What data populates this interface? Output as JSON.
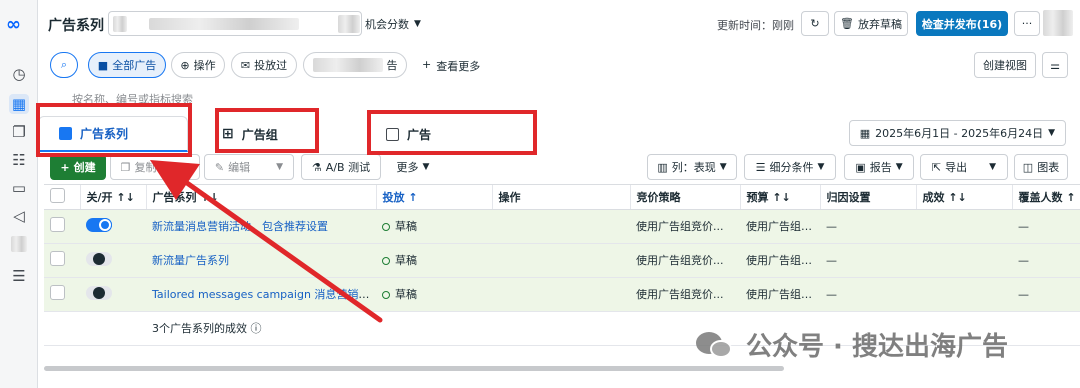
{
  "nav": {
    "meta_logo": "∞"
  },
  "header": {
    "title": "广告系列",
    "opportunity_score": "机会分数",
    "updated_time": "更新时间：刚刚",
    "discard_label": "放弃草稿",
    "publish_label": "检查并发布(16)",
    "more_label": "···"
  },
  "filters": {
    "all_ads": "全部广告",
    "actions": "操作",
    "delivered": "投放过",
    "blurred_suffix": "告",
    "view_more": "查看更多",
    "create_view": "创建视图"
  },
  "search": {
    "placeholder": "按名称、编号或指标搜索"
  },
  "tabs": [
    {
      "label": "广告系列"
    },
    {
      "label": "广告组"
    },
    {
      "label": "广告"
    }
  ],
  "date_range": "2025年6月1日 - 2025年6月24日",
  "toolbar": {
    "create": "创建",
    "copy": "复制",
    "edit": "编辑",
    "ab_test": "A/B 测试",
    "more": "更多",
    "columns": "列：表现",
    "breakdown": "细分条件",
    "reports": "报告",
    "export": "导出",
    "charts": "图表"
  },
  "table": {
    "columns": [
      "关/开 ↑↓",
      "广告系列 ↑↓",
      "投放 ↑",
      "操作",
      "竞价策略",
      "预算 ↑↓",
      "归因设置",
      "成效 ↑↓",
      "覆盖人数 ↑"
    ],
    "rows": [
      {
        "toggle": "on",
        "name": "新流量消息营销活动，包含推荐设置",
        "delivery": "草稿",
        "bid": "使用广告组竞价...",
        "budget": "使用广告组预算",
        "attribution": "—",
        "results": "—"
      },
      {
        "toggle": "off",
        "name": "新流量广告系列",
        "delivery": "草稿",
        "bid": "使用广告组竞价...",
        "budget": "使用广告组预算",
        "attribution": "—",
        "results": "—"
      },
      {
        "toggle": "off",
        "name": "Tailored messages campaign 消息营销活动 2...",
        "delivery": "草稿",
        "bid": "使用广告组竞价...",
        "budget": "使用广告组预算",
        "attribution": "—",
        "results": "—"
      }
    ],
    "summary": "3个广告系列的成效"
  },
  "watermark": "公众号 · 搜达出海广告",
  "colors": {
    "accent": "#1877f2",
    "primary": "#0a78be",
    "create": "#1e7e34",
    "annotation": "#e0272a",
    "row_bg": "#eef6e7"
  }
}
